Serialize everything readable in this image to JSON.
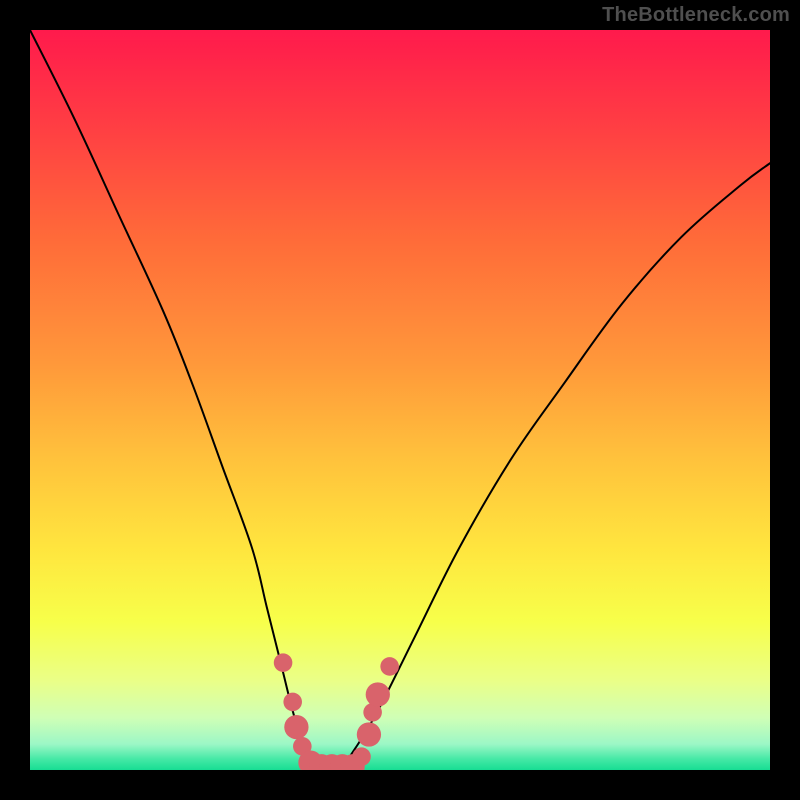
{
  "watermark": "TheBottleneck.com",
  "chart_data": {
    "type": "line",
    "title": "",
    "xlabel": "",
    "ylabel": "",
    "xlim": [
      0,
      100
    ],
    "ylim": [
      0,
      100
    ],
    "grid": false,
    "legend": false,
    "notes": "Bottleneck-style V curve over vertical rainbow gradient; axes unlabeled; thin green band at bottom.",
    "series": [
      {
        "name": "bottleneck-curve",
        "x": [
          0,
          6,
          12,
          18,
          22,
          26,
          30,
          32,
          34,
          35.5,
          37,
          38.5,
          40,
          42,
          44,
          47,
          52,
          58,
          65,
          72,
          80,
          88,
          96,
          100
        ],
        "y": [
          100,
          88,
          75,
          62,
          52,
          41,
          30,
          22,
          14,
          8,
          3,
          0.5,
          0.5,
          0.5,
          3,
          8,
          18,
          30,
          42,
          52,
          63,
          72,
          79,
          82
        ]
      }
    ],
    "markers": {
      "name": "bottom-dots",
      "color": "#d9636b",
      "points": [
        {
          "x": 34.2,
          "y": 14.5,
          "r": 1.3
        },
        {
          "x": 35.5,
          "y": 9.2,
          "r": 1.3
        },
        {
          "x": 36.0,
          "y": 5.8,
          "r": 2.0
        },
        {
          "x": 36.8,
          "y": 3.2,
          "r": 1.3
        },
        {
          "x": 37.9,
          "y": 1.0,
          "r": 2.0
        },
        {
          "x": 39.4,
          "y": 0.5,
          "r": 2.0
        },
        {
          "x": 40.8,
          "y": 0.5,
          "r": 2.0
        },
        {
          "x": 42.2,
          "y": 0.5,
          "r": 2.0
        },
        {
          "x": 43.6,
          "y": 0.5,
          "r": 2.0
        },
        {
          "x": 44.8,
          "y": 1.8,
          "r": 1.3
        },
        {
          "x": 45.8,
          "y": 4.8,
          "r": 2.0
        },
        {
          "x": 46.3,
          "y": 7.8,
          "r": 1.3
        },
        {
          "x": 47.0,
          "y": 10.2,
          "r": 2.0
        },
        {
          "x": 48.6,
          "y": 14.0,
          "r": 1.3
        }
      ]
    },
    "gradient_stops": [
      {
        "offset": 0.0,
        "color": "#ff1a4c"
      },
      {
        "offset": 0.12,
        "color": "#ff3b44"
      },
      {
        "offset": 0.28,
        "color": "#ff6a39"
      },
      {
        "offset": 0.45,
        "color": "#ff983a"
      },
      {
        "offset": 0.58,
        "color": "#ffc23c"
      },
      {
        "offset": 0.7,
        "color": "#ffe53e"
      },
      {
        "offset": 0.8,
        "color": "#f7ff4a"
      },
      {
        "offset": 0.88,
        "color": "#eaff88"
      },
      {
        "offset": 0.93,
        "color": "#cfffb6"
      },
      {
        "offset": 0.965,
        "color": "#9cf7c6"
      },
      {
        "offset": 0.985,
        "color": "#46e9a6"
      },
      {
        "offset": 1.0,
        "color": "#17dd93"
      }
    ]
  }
}
